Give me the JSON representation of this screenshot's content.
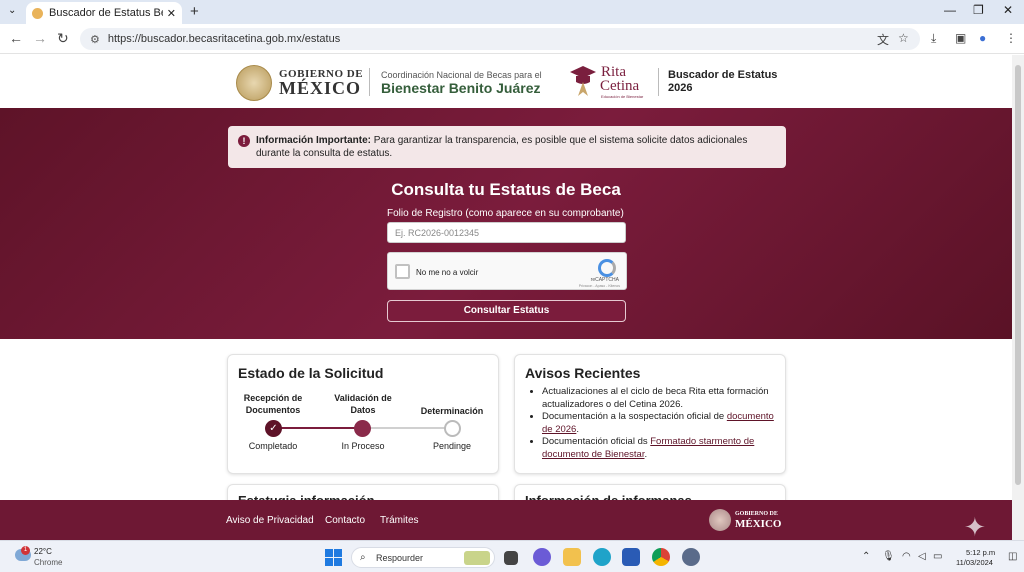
{
  "browser": {
    "tab_title": "Buscador de Estatus Beca Rita C",
    "url": "https://buscador.becasritacetina.gob.mx/estatus"
  },
  "header": {
    "gob_line1": "GOBIERNO DE",
    "gob_line2": "MÉXICO",
    "coord_line1": "Coordinación Nacional de Becas para el",
    "coord_line2": "Bienestar Benito Juárez",
    "rc_line1": "Rita",
    "rc_line2": "Cetina",
    "rc_tag": "Educación de Bienestar",
    "buscador_line1": "Buscador de Estatus",
    "buscador_line2": "2026"
  },
  "alert": {
    "icon": "exclamation-icon",
    "bold": "Información Importante:",
    "text": " Para garantizar la transparencia, es posible que el sistema solicite datos adicionales durante la consulta de estatus."
  },
  "form": {
    "title": "Consulta tu Estatus de Beca",
    "folio_label": "Folio de Registro (como aparece en su comprobante)",
    "folio_placeholder": "Ej. RC2026-0012345",
    "captcha_label": "No me no a volcir",
    "captcha_brand": "reCAPTCHA",
    "captcha_links": "Privacon - Apaso - Kitenos",
    "submit_label": "Consultar Estatus"
  },
  "status_card": {
    "title": "Estado de la Solicitud",
    "steps": [
      {
        "label": "Recepción de Documentos",
        "status": "Completado"
      },
      {
        "label": "Validación de Datos",
        "status": "In Proceso"
      },
      {
        "label": "Determinación",
        "status": "Pendinge"
      }
    ],
    "colors": {
      "done": "#5e1328",
      "current": "#8a2a4a",
      "pending": "#cccccc"
    }
  },
  "news_card": {
    "title": "Avisos Recientes",
    "items": [
      {
        "text": "Actualizaciones al el ciclo de beca Rita etta formación actualizadores o del Cetina 2026.",
        "link": "",
        "after": ""
      },
      {
        "text": "Documentación a la sospectación oficial de ",
        "link": "documento de 2026",
        "after": "."
      },
      {
        "text": "Documentación oficial ds ",
        "link": "Formatado starmento de documento de Bienestar",
        "after": "."
      }
    ]
  },
  "lower_cards": {
    "left_title": "Estatuɑia información",
    "right_title": "Información de informanas"
  },
  "footer": {
    "links": [
      "Aviso de Privacidad",
      "Contacto",
      "Trámites"
    ],
    "gob_line1": "GOBIERNO DE",
    "gob_line2": "MÉXICO"
  },
  "taskbar": {
    "weather_temp": "22°C",
    "weather_sub": "Chrome",
    "weather_badge": "1",
    "search_label": "Respourder",
    "time": "5:12 p.m",
    "date": "11/03/2024"
  },
  "theme": {
    "primary": "#7b1c3c",
    "footer": "#6e1834",
    "gob_green": "#355e3b"
  }
}
